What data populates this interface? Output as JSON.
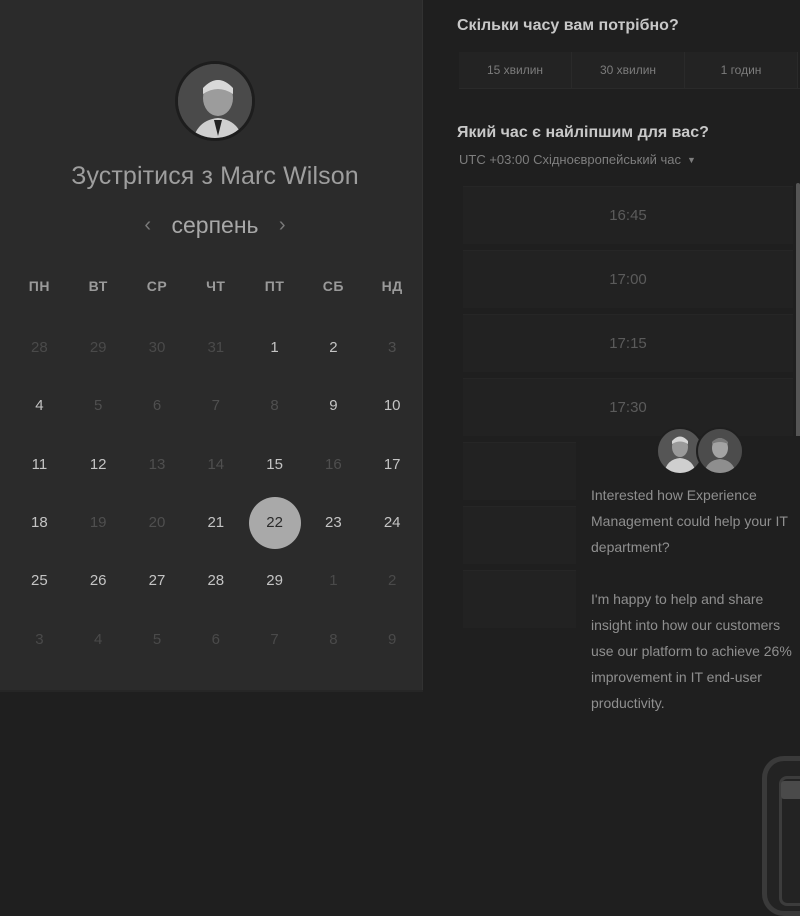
{
  "left": {
    "title_prefix": "Зустрітися з",
    "title_name": "Marc Wilson",
    "month": "серпень",
    "prev_icon": "‹",
    "next_icon": "›",
    "weekdays": [
      "ПН",
      "ВТ",
      "СР",
      "ЧТ",
      "ПТ",
      "СБ",
      "НД"
    ],
    "weeks": [
      [
        {
          "d": "28",
          "s": "out"
        },
        {
          "d": "29",
          "s": "out"
        },
        {
          "d": "30",
          "s": "out"
        },
        {
          "d": "31",
          "s": "out"
        },
        {
          "d": "1",
          "s": "in"
        },
        {
          "d": "2",
          "s": "in"
        },
        {
          "d": "3",
          "s": "dis"
        }
      ],
      [
        {
          "d": "4",
          "s": "in"
        },
        {
          "d": "5",
          "s": "dis"
        },
        {
          "d": "6",
          "s": "dis"
        },
        {
          "d": "7",
          "s": "dis"
        },
        {
          "d": "8",
          "s": "dis"
        },
        {
          "d": "9",
          "s": "in"
        },
        {
          "d": "10",
          "s": "in"
        }
      ],
      [
        {
          "d": "11",
          "s": "in"
        },
        {
          "d": "12",
          "s": "in"
        },
        {
          "d": "13",
          "s": "dis"
        },
        {
          "d": "14",
          "s": "dis"
        },
        {
          "d": "15",
          "s": "in"
        },
        {
          "d": "16",
          "s": "dis"
        },
        {
          "d": "17",
          "s": "in"
        }
      ],
      [
        {
          "d": "18",
          "s": "in"
        },
        {
          "d": "19",
          "s": "dis"
        },
        {
          "d": "20",
          "s": "dis"
        },
        {
          "d": "21",
          "s": "in"
        },
        {
          "d": "22",
          "s": "sel"
        },
        {
          "d": "23",
          "s": "in"
        },
        {
          "d": "24",
          "s": "in"
        }
      ],
      [
        {
          "d": "25",
          "s": "in"
        },
        {
          "d": "26",
          "s": "in"
        },
        {
          "d": "27",
          "s": "in"
        },
        {
          "d": "28",
          "s": "in"
        },
        {
          "d": "29",
          "s": "in"
        },
        {
          "d": "1",
          "s": "out"
        },
        {
          "d": "2",
          "s": "out"
        }
      ],
      [
        {
          "d": "3",
          "s": "out"
        },
        {
          "d": "4",
          "s": "out"
        },
        {
          "d": "5",
          "s": "out"
        },
        {
          "d": "6",
          "s": "out"
        },
        {
          "d": "7",
          "s": "out"
        },
        {
          "d": "8",
          "s": "out"
        },
        {
          "d": "9",
          "s": "out"
        }
      ]
    ]
  },
  "right": {
    "duration_question": "Скільки часу вам потрібно?",
    "durations": [
      "15 хвилин",
      "30 хвилин",
      "1 годин"
    ],
    "time_question": "Який час є найліпшим для вас?",
    "timezone": "UTC +03:00 Східноєвропейський час",
    "slots": [
      "16:45",
      "17:00",
      "17:15",
      "17:30",
      "",
      "",
      ""
    ]
  },
  "chat": {
    "message_1": "Interested how Experience Management could help your IT department?",
    "message_2": "I'm happy to help and share insight into how our customers use our platform to achieve 26% improvement in IT end-user productivity."
  },
  "icons": {
    "avatar": "person-photo-icon",
    "launcher": "chat-launcher-icon",
    "tz_caret": "caret-down-icon"
  }
}
